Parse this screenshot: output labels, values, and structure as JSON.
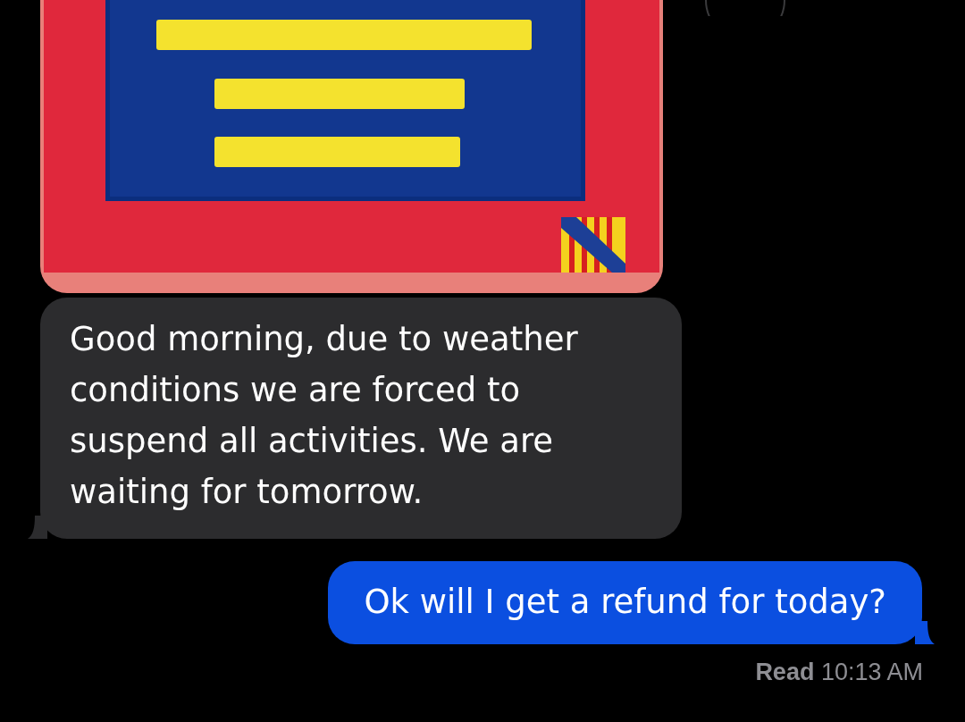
{
  "messages": [
    {
      "kind": "picture",
      "outgoing": false
    },
    {
      "kind": "text",
      "outgoing": false,
      "text": "Good morning, due to weather conditions we are forced to suspend all activities. We are waiting for tomorrow."
    },
    {
      "kind": "text",
      "outgoing": true,
      "text": "Ok will I get a refund for today?"
    }
  ],
  "receipt": "**Read** 10:13 AM"
}
